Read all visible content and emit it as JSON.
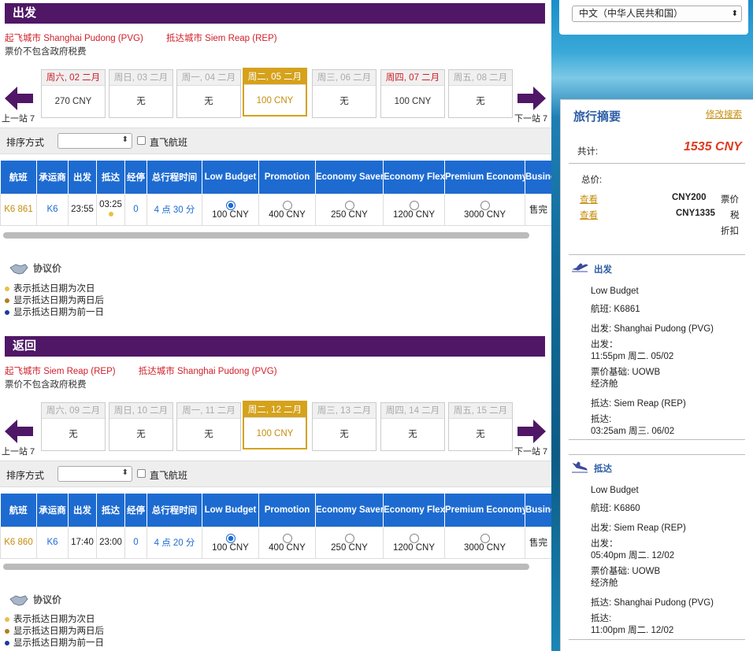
{
  "outbound": {
    "header": "出发",
    "from": "起飞城市 Shanghai Pudong (PVG)",
    "to": "抵达城市 Siem Reap (REP)",
    "tax_note": "票价不包含政府税费",
    "prev_label": "上一站 7",
    "next_label": "下一站 7",
    "dates": [
      {
        "day": "周六, 02 二月",
        "price": "270 CNY",
        "red": true,
        "selected": false
      },
      {
        "day": "周日, 03 二月",
        "price": "无",
        "red": false,
        "selected": false
      },
      {
        "day": "周一, 04 二月",
        "price": "无",
        "red": false,
        "selected": false
      },
      {
        "day": "周二, 05 二月",
        "price": "100 CNY",
        "red": false,
        "selected": true
      },
      {
        "day": "周三, 06 二月",
        "price": "无",
        "red": false,
        "selected": false
      },
      {
        "day": "周四, 07 二月",
        "price": "100 CNY",
        "red": true,
        "selected": false
      },
      {
        "day": "周五, 08 二月",
        "price": "无",
        "red": false,
        "selected": false
      }
    ],
    "sort_label": "排序方式",
    "direct_label": "直飞航班",
    "columns": [
      "航班",
      "承运商",
      "出发",
      "抵达",
      "经停",
      "总行程时间",
      "Low Budget",
      "Promotion",
      "Economy Saver",
      "Economy Flex",
      "Premium Economy",
      "Business"
    ],
    "row": {
      "flight": "K6 861",
      "carrier": "K6",
      "depart": "23:55",
      "arrive": "03:25",
      "stops": "0",
      "duration": "4 点 30 分",
      "fares": [
        "100 CNY",
        "400 CNY",
        "250 CNY",
        "1200 CNY",
        "3000 CNY",
        "售完"
      ]
    },
    "legend_title": "协议价",
    "legend": [
      "表示抵达日期为次日",
      "显示抵达日期为两日后",
      "显示抵达日期为前一日"
    ]
  },
  "return": {
    "header": "返回",
    "from": "起飞城市 Siem Reap (REP)",
    "to": "抵达城市 Shanghai Pudong (PVG)",
    "tax_note": "票价不包含政府税费",
    "prev_label": "上一站 7",
    "next_label": "下一站 7",
    "dates": [
      {
        "day": "周六, 09 二月",
        "price": "无",
        "red": false,
        "selected": false
      },
      {
        "day": "周日, 10 二月",
        "price": "无",
        "red": false,
        "selected": false
      },
      {
        "day": "周一, 11 二月",
        "price": "无",
        "red": false,
        "selected": false
      },
      {
        "day": "周二, 12 二月",
        "price": "100 CNY",
        "red": false,
        "selected": true
      },
      {
        "day": "周三, 13 二月",
        "price": "无",
        "red": false,
        "selected": false
      },
      {
        "day": "周四, 14 二月",
        "price": "无",
        "red": false,
        "selected": false
      },
      {
        "day": "周五, 15 二月",
        "price": "无",
        "red": false,
        "selected": false
      }
    ],
    "sort_label": "排序方式",
    "direct_label": "直飞航班",
    "columns": [
      "航班",
      "承运商",
      "出发",
      "抵达",
      "经停",
      "总行程时间",
      "Low Budget",
      "Promotion",
      "Economy Saver",
      "Economy Flex",
      "Premium Economy",
      "Business"
    ],
    "row": {
      "flight": "K6 860",
      "carrier": "K6",
      "depart": "17:40",
      "arrive": "23:00",
      "stops": "0",
      "duration": "4 点 20 分",
      "fares": [
        "100 CNY",
        "400 CNY",
        "250 CNY",
        "1200 CNY",
        "3000 CNY",
        "售完"
      ]
    },
    "legend_title": "协议价",
    "legend": [
      "表示抵达日期为次日",
      "显示抵达日期为两日后",
      "显示抵达日期为前一日"
    ]
  },
  "language": "中文（中华人民共和国）",
  "summary": {
    "title": "旅行摘要",
    "modify": "修改搜索",
    "total_label": "共计:",
    "total": "1535 CNY",
    "price_label": "总价:",
    "view1": "查看",
    "amount1": "CNY200",
    "type1": "票价",
    "view2": "查看",
    "amount2": "CNY1335",
    "type2": "税",
    "discount": "折扣",
    "depart": {
      "label": "出发",
      "fare": "Low Budget",
      "flight": "航班:   K6861",
      "from": "出发:   Shanghai Pudong (PVG)",
      "time_label": "出发：",
      "time": "11:55pm 周二. 05/02",
      "basis": "票价基础:   UOWB",
      "cabin": "经济舱",
      "to": "抵达:   Siem Reap (REP)",
      "arr_label": "抵达:",
      "arr_time": "03:25am 周三. 06/02"
    },
    "arrive": {
      "label": "抵达",
      "fare": "Low Budget",
      "flight": "航班:   K6860",
      "from": "出发:   Siem Reap (REP)",
      "time_label": "出发：",
      "time": "05:40pm 周二. 12/02",
      "basis": "票价基础:   UOWB",
      "cabin": "经济舱",
      "to": "抵达:   Shanghai Pudong (PVG)",
      "arr_label": "抵达:",
      "arr_time": "11:00pm 周二. 12/02"
    }
  },
  "colors": {
    "header": "#4f1766",
    "table_head": "#1d6bd1",
    "selected": "#d6a21c",
    "route": "#d0202a",
    "total": "#e03a1e"
  }
}
